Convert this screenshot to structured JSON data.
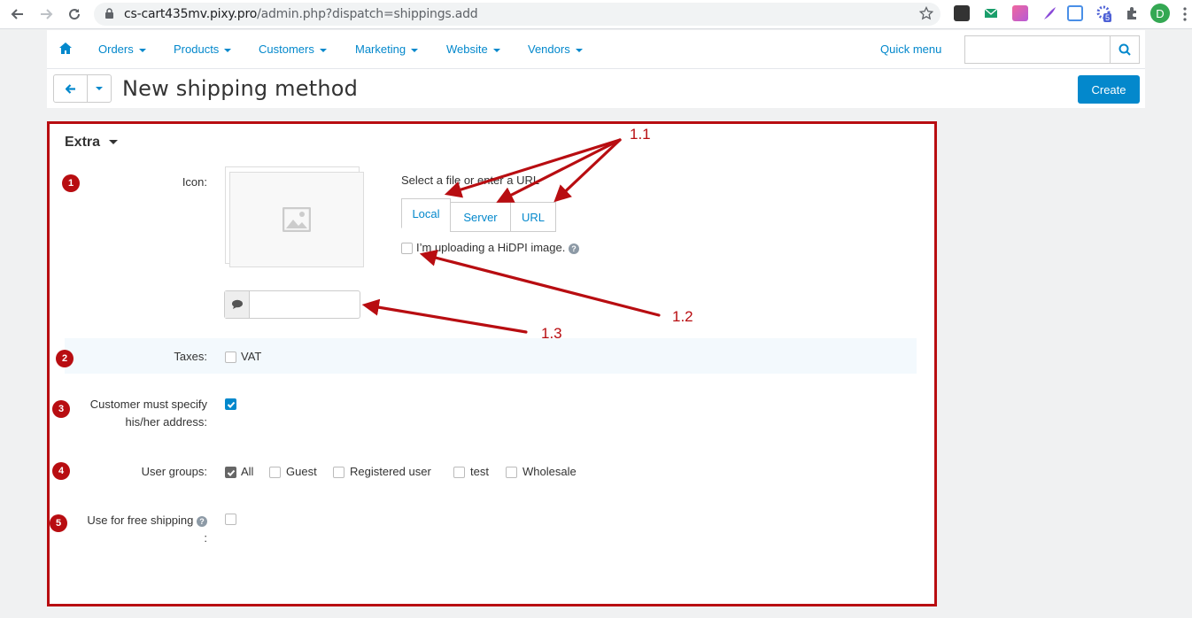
{
  "browser": {
    "url_main": "cs-cart435mv.pixy.pro",
    "url_path": "/admin.php?dispatch=shippings.add",
    "profile_initial": "D",
    "ext_badge": "5"
  },
  "nav": {
    "items": [
      "Orders",
      "Products",
      "Customers",
      "Marketing",
      "Website",
      "Vendors"
    ],
    "quick_menu": "Quick menu"
  },
  "header": {
    "title": "New shipping method",
    "create_label": "Create"
  },
  "section": {
    "title": "Extra"
  },
  "icon_field": {
    "label": "Icon:",
    "select_text": "Select a file or enter a URL",
    "tabs": [
      "Local",
      "Server",
      "URL"
    ],
    "hidpi_label": "I’m uploading a HiDPI image.",
    "alt_value": ""
  },
  "taxes": {
    "label": "Taxes:",
    "option": "VAT"
  },
  "address": {
    "label_line1": "Customer must specify",
    "label_line2": "his/her address:",
    "checked": true
  },
  "user_groups": {
    "label": "User groups:",
    "options": [
      "All",
      "Guest",
      "Registered user",
      "test",
      "Wholesale"
    ]
  },
  "free_shipping": {
    "label": "Use for free shipping",
    "label_tail": ":"
  },
  "annotations": {
    "badges": [
      "1",
      "2",
      "3",
      "4",
      "5"
    ],
    "labels": [
      "1.1",
      "1.2",
      "1.3"
    ],
    "color": "#b80d11"
  },
  "colors": {
    "accent": "#0388cc",
    "annotation": "#b80d11"
  }
}
